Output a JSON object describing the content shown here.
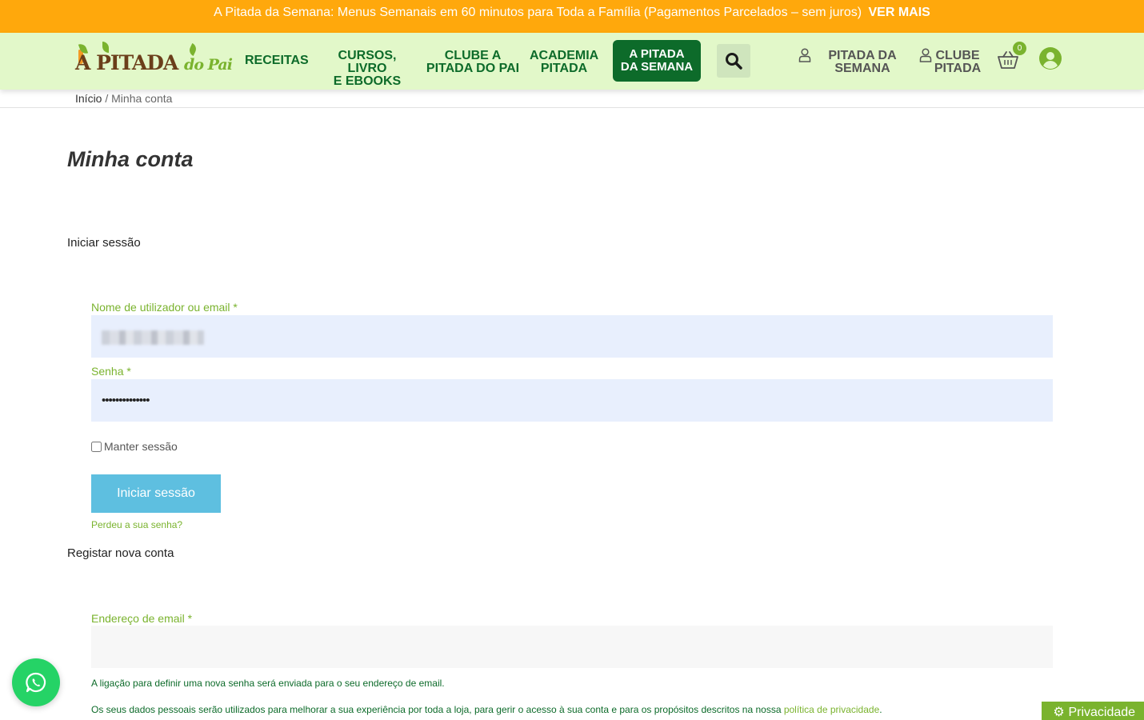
{
  "promo": {
    "text": "A Pitada da Semana: Menus Semanais em 60 minutos para Toda a Família (Pagamentos Parcelados – sem juros)",
    "cta": "VER MAIS"
  },
  "logo": {
    "text_main": "A PITADA",
    "text_sub": "do Pai"
  },
  "nav": {
    "receitas": "RECEITAS",
    "cursos_line1": "CURSOS, LIVRO",
    "cursos_line2": "E EBOOKS",
    "clube_line1": "CLUBE A",
    "clube_line2": "PITADA DO PAI",
    "academia_line1": "ACADEMIA",
    "academia_line2": "PITADA",
    "cta_line1": "A PITADA",
    "cta_line2": "DA SEMANA"
  },
  "user_links": {
    "pitada_line1": "PITADA DA",
    "pitada_line2": "SEMANA",
    "clube_line1": "CLUBE",
    "clube_line2": "PITADA"
  },
  "cart": {
    "count": "0"
  },
  "breadcrumb": {
    "home": "Início",
    "separator": " / ",
    "current": "Minha conta"
  },
  "page": {
    "title": "Minha conta"
  },
  "login": {
    "heading": "Iniciar sessão",
    "username_label": "Nome de utilizador ou email *",
    "password_label": "Senha *",
    "password_value": "••••••••••••••",
    "remember_label": "Manter sessão",
    "submit_label": "Iniciar sessão",
    "lost_password": "Perdeu a sua senha?"
  },
  "register": {
    "heading": "Registar nova conta",
    "email_label": "Endereço de email *",
    "password_note": "A ligação para definir uma nova senha será enviada para o seu endereço de email.",
    "privacy_note_prefix": "Os seus dados pessoais serão utilizados para melhorar a sua experiência por toda a loja, para gerir o acesso à sua conta e para os propósitos descritos na nossa ",
    "privacy_link": "política de privacidade",
    "privacy_note_suffix": "."
  },
  "privacy_badge": "Privacidade",
  "colors": {
    "promo_bg": "#ffa80c",
    "header_bg": "#e2f8c9",
    "brand_green": "#0d6b2a",
    "accent_green": "#7ab32e",
    "button_blue": "#5ebfe0",
    "input_fill": "#e8effd",
    "whatsapp": "#25d366"
  },
  "icons": [
    "search-icon",
    "user-outline-icon",
    "cart-icon",
    "account-icon",
    "whatsapp-icon",
    "gear-icon"
  ]
}
